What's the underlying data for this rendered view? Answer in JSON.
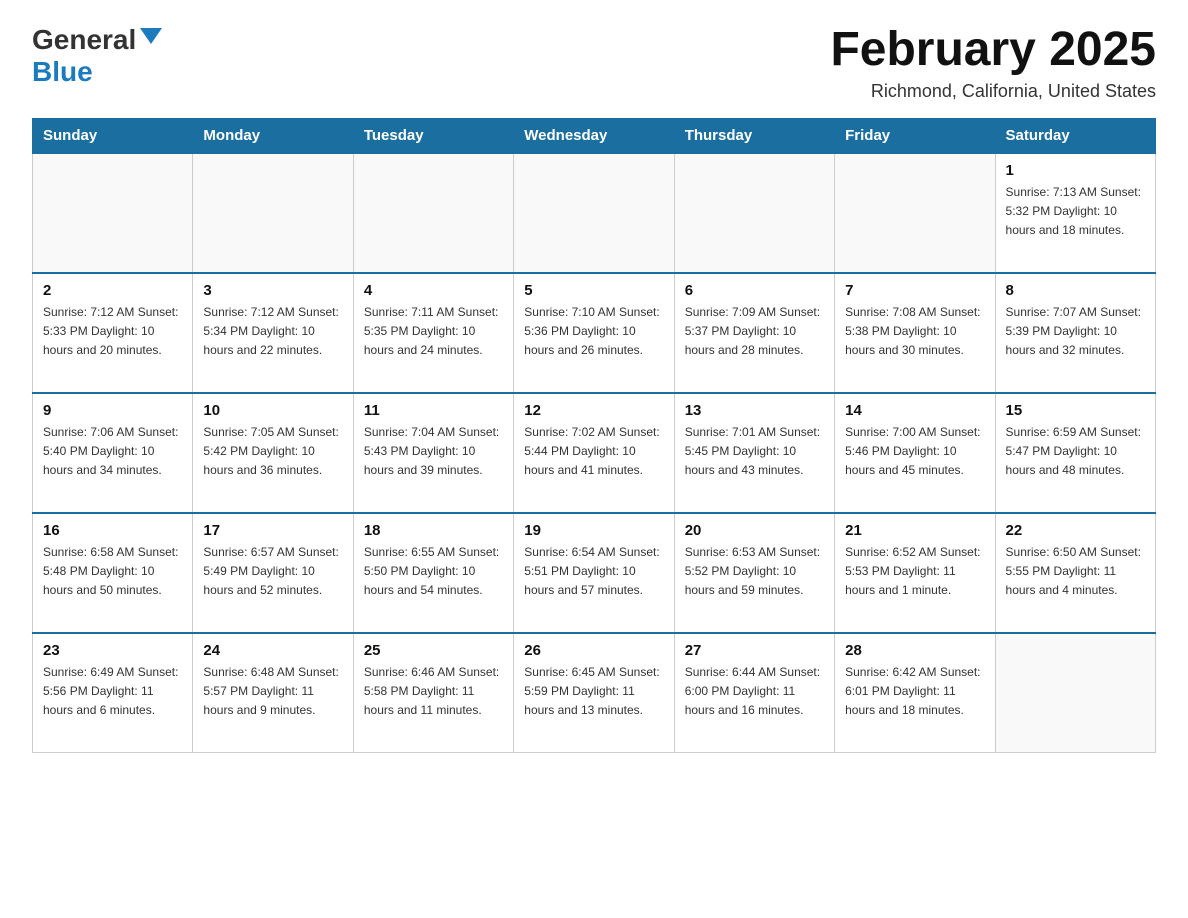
{
  "header": {
    "logo_general": "General",
    "logo_blue": "Blue",
    "title": "February 2025",
    "location": "Richmond, California, United States"
  },
  "calendar": {
    "days_of_week": [
      "Sunday",
      "Monday",
      "Tuesday",
      "Wednesday",
      "Thursday",
      "Friday",
      "Saturday"
    ],
    "weeks": [
      [
        {
          "day": "",
          "info": ""
        },
        {
          "day": "",
          "info": ""
        },
        {
          "day": "",
          "info": ""
        },
        {
          "day": "",
          "info": ""
        },
        {
          "day": "",
          "info": ""
        },
        {
          "day": "",
          "info": ""
        },
        {
          "day": "1",
          "info": "Sunrise: 7:13 AM\nSunset: 5:32 PM\nDaylight: 10 hours and 18 minutes."
        }
      ],
      [
        {
          "day": "2",
          "info": "Sunrise: 7:12 AM\nSunset: 5:33 PM\nDaylight: 10 hours and 20 minutes."
        },
        {
          "day": "3",
          "info": "Sunrise: 7:12 AM\nSunset: 5:34 PM\nDaylight: 10 hours and 22 minutes."
        },
        {
          "day": "4",
          "info": "Sunrise: 7:11 AM\nSunset: 5:35 PM\nDaylight: 10 hours and 24 minutes."
        },
        {
          "day": "5",
          "info": "Sunrise: 7:10 AM\nSunset: 5:36 PM\nDaylight: 10 hours and 26 minutes."
        },
        {
          "day": "6",
          "info": "Sunrise: 7:09 AM\nSunset: 5:37 PM\nDaylight: 10 hours and 28 minutes."
        },
        {
          "day": "7",
          "info": "Sunrise: 7:08 AM\nSunset: 5:38 PM\nDaylight: 10 hours and 30 minutes."
        },
        {
          "day": "8",
          "info": "Sunrise: 7:07 AM\nSunset: 5:39 PM\nDaylight: 10 hours and 32 minutes."
        }
      ],
      [
        {
          "day": "9",
          "info": "Sunrise: 7:06 AM\nSunset: 5:40 PM\nDaylight: 10 hours and 34 minutes."
        },
        {
          "day": "10",
          "info": "Sunrise: 7:05 AM\nSunset: 5:42 PM\nDaylight: 10 hours and 36 minutes."
        },
        {
          "day": "11",
          "info": "Sunrise: 7:04 AM\nSunset: 5:43 PM\nDaylight: 10 hours and 39 minutes."
        },
        {
          "day": "12",
          "info": "Sunrise: 7:02 AM\nSunset: 5:44 PM\nDaylight: 10 hours and 41 minutes."
        },
        {
          "day": "13",
          "info": "Sunrise: 7:01 AM\nSunset: 5:45 PM\nDaylight: 10 hours and 43 minutes."
        },
        {
          "day": "14",
          "info": "Sunrise: 7:00 AM\nSunset: 5:46 PM\nDaylight: 10 hours and 45 minutes."
        },
        {
          "day": "15",
          "info": "Sunrise: 6:59 AM\nSunset: 5:47 PM\nDaylight: 10 hours and 48 minutes."
        }
      ],
      [
        {
          "day": "16",
          "info": "Sunrise: 6:58 AM\nSunset: 5:48 PM\nDaylight: 10 hours and 50 minutes."
        },
        {
          "day": "17",
          "info": "Sunrise: 6:57 AM\nSunset: 5:49 PM\nDaylight: 10 hours and 52 minutes."
        },
        {
          "day": "18",
          "info": "Sunrise: 6:55 AM\nSunset: 5:50 PM\nDaylight: 10 hours and 54 minutes."
        },
        {
          "day": "19",
          "info": "Sunrise: 6:54 AM\nSunset: 5:51 PM\nDaylight: 10 hours and 57 minutes."
        },
        {
          "day": "20",
          "info": "Sunrise: 6:53 AM\nSunset: 5:52 PM\nDaylight: 10 hours and 59 minutes."
        },
        {
          "day": "21",
          "info": "Sunrise: 6:52 AM\nSunset: 5:53 PM\nDaylight: 11 hours and 1 minute."
        },
        {
          "day": "22",
          "info": "Sunrise: 6:50 AM\nSunset: 5:55 PM\nDaylight: 11 hours and 4 minutes."
        }
      ],
      [
        {
          "day": "23",
          "info": "Sunrise: 6:49 AM\nSunset: 5:56 PM\nDaylight: 11 hours and 6 minutes."
        },
        {
          "day": "24",
          "info": "Sunrise: 6:48 AM\nSunset: 5:57 PM\nDaylight: 11 hours and 9 minutes."
        },
        {
          "day": "25",
          "info": "Sunrise: 6:46 AM\nSunset: 5:58 PM\nDaylight: 11 hours and 11 minutes."
        },
        {
          "day": "26",
          "info": "Sunrise: 6:45 AM\nSunset: 5:59 PM\nDaylight: 11 hours and 13 minutes."
        },
        {
          "day": "27",
          "info": "Sunrise: 6:44 AM\nSunset: 6:00 PM\nDaylight: 11 hours and 16 minutes."
        },
        {
          "day": "28",
          "info": "Sunrise: 6:42 AM\nSunset: 6:01 PM\nDaylight: 11 hours and 18 minutes."
        },
        {
          "day": "",
          "info": ""
        }
      ]
    ]
  }
}
